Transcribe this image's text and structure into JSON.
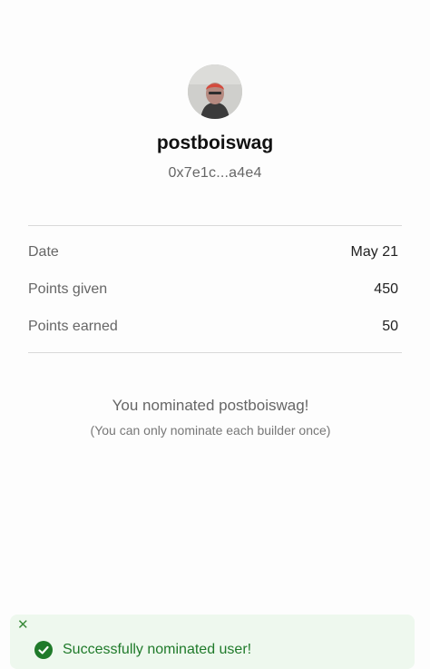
{
  "profile": {
    "avatar_icon": "user-avatar",
    "username": "postboiswag",
    "address": "0x7e1c...a4e4"
  },
  "stats": [
    {
      "label": "Date",
      "value": "May 21"
    },
    {
      "label": "Points given",
      "value": "450"
    },
    {
      "label": "Points earned",
      "value": "50"
    }
  ],
  "nomination": {
    "message": "You nominated postboiswag!",
    "note": "(You can only nominate each builder once)"
  },
  "toast": {
    "close_icon": "close-icon",
    "status_icon": "check-circle-icon",
    "message": "Successfully nominated user!",
    "color": "#1f7a2a",
    "background": "#eef8ee"
  }
}
